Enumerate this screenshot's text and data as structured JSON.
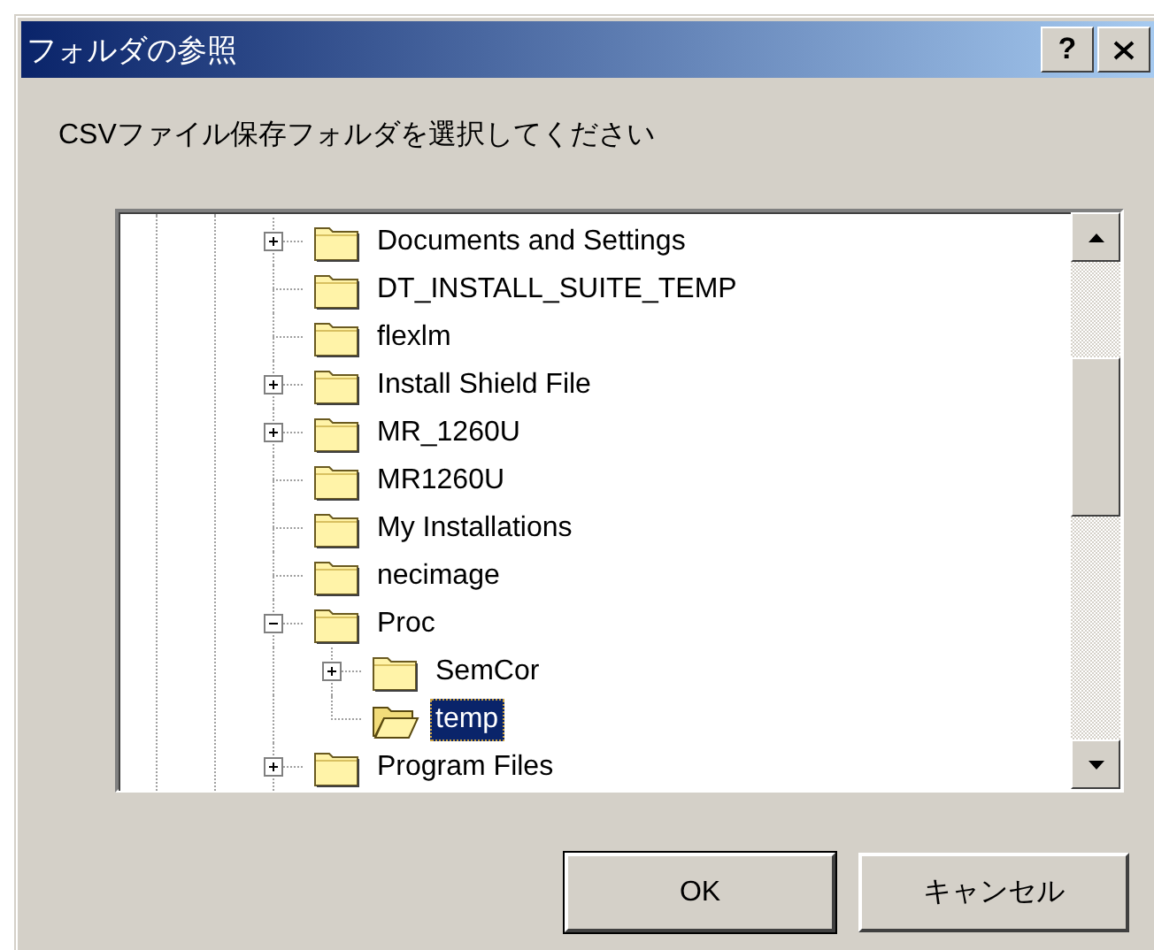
{
  "window": {
    "title": "フォルダの参照",
    "help_button": "?"
  },
  "instruction": "CSVファイル保存フォルダを選択してください",
  "tree": {
    "items": [
      {
        "label": "Documents and Settings",
        "kind": "branch",
        "expanded": false,
        "selected": false
      },
      {
        "label": "DT_INSTALL_SUITE_TEMP",
        "kind": "leaf",
        "selected": false
      },
      {
        "label": "flexlm",
        "kind": "leaf",
        "selected": false
      },
      {
        "label": "Install Shield File",
        "kind": "branch",
        "expanded": false,
        "selected": false
      },
      {
        "label": "MR_1260U",
        "kind": "branch",
        "expanded": false,
        "selected": false
      },
      {
        "label": "MR1260U",
        "kind": "leaf",
        "selected": false
      },
      {
        "label": "My Installations",
        "kind": "leaf",
        "selected": false
      },
      {
        "label": "necimage",
        "kind": "leaf",
        "selected": false
      },
      {
        "label": "Proc",
        "kind": "branch",
        "expanded": true,
        "selected": false,
        "children": [
          {
            "label": "SemCor",
            "kind": "branch",
            "expanded": false,
            "selected": false
          },
          {
            "label": "temp",
            "kind": "leaf",
            "selected": true
          }
        ]
      },
      {
        "label": "Program Files",
        "kind": "branch",
        "expanded": false,
        "selected": false
      }
    ]
  },
  "buttons": [
    {
      "label": "OK",
      "default": true
    },
    {
      "label": "キャンセル",
      "default": false
    }
  ]
}
